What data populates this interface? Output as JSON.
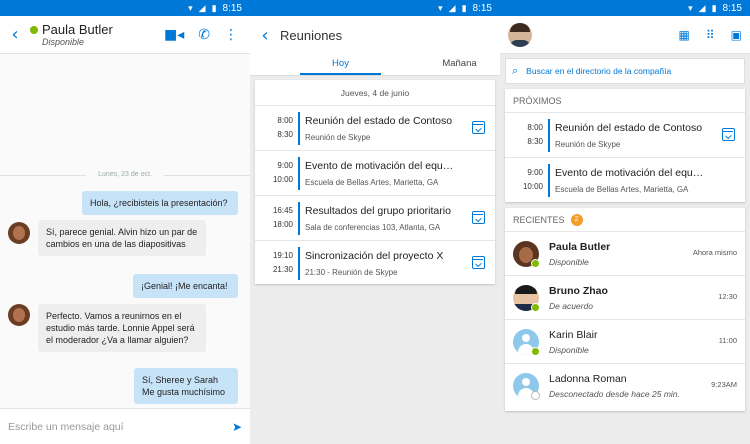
{
  "status_bar": {
    "time": "8:15"
  },
  "chat": {
    "contact_name": "Paula Butler",
    "contact_status": "Disponible",
    "date_separator": "Lunes, 23 de oct.",
    "messages": [
      {
        "dir": "out",
        "text": "Hola, ¿recibisteis la presentación?"
      },
      {
        "dir": "in",
        "text": "Sí, parece genial. Alvin hizo un par de cambios en una de las diapositivas"
      },
      {
        "dir": "out",
        "text": "¡Genial! ¡Me encanta!"
      },
      {
        "dir": "in",
        "text": "Perfecto. Vamos a reunirnos en el estudio más tarde. Lonnie Appel será el moderador ¿Va a llamar alguien?"
      },
      {
        "dir": "out",
        "text": "Sí, Sheree y Sarah Me gusta muchísimo"
      }
    ],
    "composer_placeholder": "Escribe un mensaje aquí"
  },
  "meetings": {
    "title": "Reuniones",
    "tabs": [
      "Hoy",
      "Mañana"
    ],
    "day_header": "Jueves, 4 de junio",
    "items": [
      {
        "start": "8:00",
        "end": "8:30",
        "title": "Reunión del estado de Contoso",
        "subtitle": "Reunión de Skype",
        "joinable": true
      },
      {
        "start": "9:00",
        "end": "10:00",
        "title": "Evento de motivación del equipo",
        "subtitle": "Escuela de Bellas Artes, Marietta, GA",
        "joinable": false
      },
      {
        "start": "16:45",
        "end": "18:00",
        "title": "Resultados del grupo prioritario",
        "subtitle": "Sala de conferencias 103, Atlanta, GA",
        "joinable": true
      },
      {
        "start": "19:10",
        "end": "21:30",
        "title": "Sincronización del proyecto X",
        "subtitle": "21:30 - Reunión de Skype",
        "joinable": true
      }
    ]
  },
  "home": {
    "search_placeholder": "Buscar en el directorio de la compañía",
    "upcoming_header": "PRÓXIMOS",
    "upcoming": [
      {
        "start": "8:00",
        "end": "8:30",
        "title": "Reunión del estado de Contoso",
        "subtitle": "Reunión de Skype",
        "joinable": true
      },
      {
        "start": "9:00",
        "end": "10:00",
        "title": "Evento de motivación del equipo",
        "subtitle": "Escuela de Bellas Artes, Marietta, GA",
        "joinable": false
      }
    ],
    "recent_header": "RECIENTES",
    "recent_count": "2",
    "recent": [
      {
        "name": "Paula Butler",
        "status": "Disponible",
        "time": "Ahora mismo",
        "bold": true,
        "avatar": "paula",
        "presence": "on"
      },
      {
        "name": "Bruno Zhao",
        "status": "De acuerdo",
        "time": "12:30",
        "bold": true,
        "avatar": "bruno",
        "presence": "on"
      },
      {
        "name": "Karin Blair",
        "status": "Disponible",
        "time": "11:00",
        "bold": false,
        "avatar": "ph",
        "presence": "on"
      },
      {
        "name": "Ladonna Roman",
        "status": "Desconectado desde hace 25 min.",
        "time": "9:23AM",
        "bold": false,
        "avatar": "ph",
        "presence": "off"
      }
    ]
  }
}
